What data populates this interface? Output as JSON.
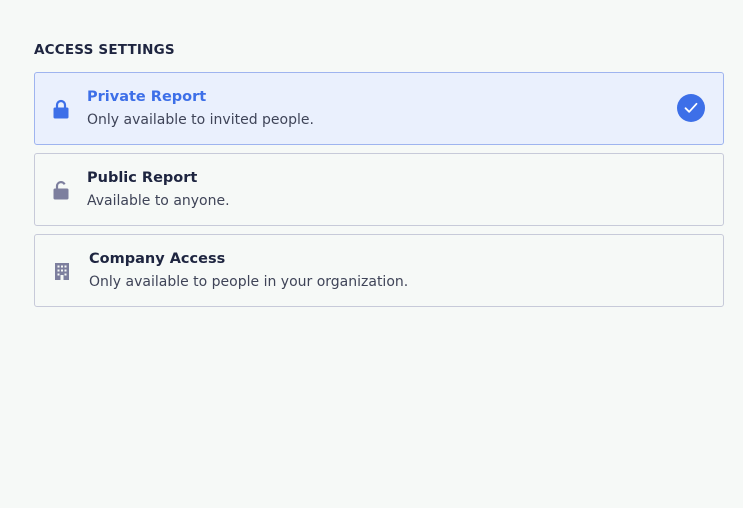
{
  "section": {
    "title": "ACCESS SETTINGS"
  },
  "options": [
    {
      "label": "Private Report",
      "description": "Only available to invited people.",
      "icon": "lock-icon",
      "selected": true
    },
    {
      "label": "Public Report",
      "description": "Available to anyone.",
      "icon": "unlock-icon",
      "selected": false
    },
    {
      "label": "Company Access",
      "description": "Only available to people in your organization.",
      "icon": "building-icon",
      "selected": false
    }
  ],
  "colors": {
    "accent": "#3d6fe8",
    "selected_bg": "#eaf0fd",
    "icon_muted": "#7d7f9e",
    "text_dark": "#1e2540"
  }
}
